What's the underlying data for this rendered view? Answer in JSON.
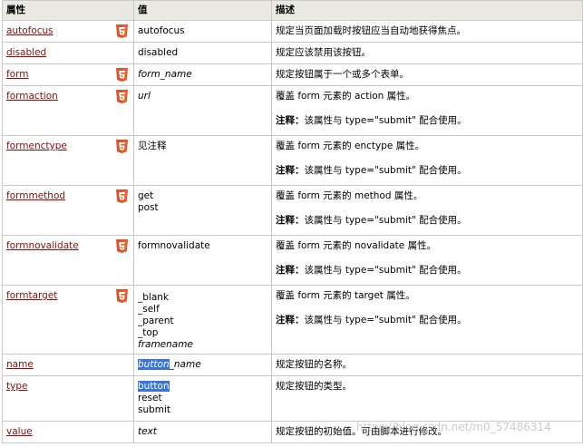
{
  "headers": [
    "属性",
    "值",
    "描述"
  ],
  "note_label": "注释：",
  "note_text": "该属性与 type=\"submit\" 配合使用。",
  "rows": [
    {
      "attr": "autofocus",
      "html5": true,
      "values": [
        "autofocus"
      ],
      "desc": "规定当页面加载时按钮应当自动地获得焦点。"
    },
    {
      "attr": "disabled",
      "html5": false,
      "values": [
        "disabled"
      ],
      "desc": "规定应该禁用该按钮。"
    },
    {
      "attr": "form",
      "html5": true,
      "values": [
        "form_name"
      ],
      "desc": "规定按钮属于一个或多个表单。"
    },
    {
      "attr": "formaction",
      "html5": true,
      "values": [
        "url"
      ],
      "desc": "覆盖 form 元素的 action 属性。"
    },
    {
      "attr": "formenctype",
      "html5": true,
      "values": [
        "见注释"
      ],
      "desc": "覆盖 form 元素的 enctype 属性。"
    },
    {
      "attr": "formmethod",
      "html5": true,
      "values": [
        "get",
        "post"
      ],
      "desc": "覆盖 form 元素的 method 属性。"
    },
    {
      "attr": "formnovalidate",
      "html5": true,
      "values": [
        "formnovalidate"
      ],
      "desc": "覆盖 form 元素的 novalidate 属性。"
    },
    {
      "attr": "formtarget",
      "html5": true,
      "values": [
        "_blank",
        "_self",
        "_parent",
        "_top",
        "framename"
      ],
      "desc": "覆盖 form 元素的 target 属性。"
    },
    {
      "attr": "name",
      "html5": false,
      "values": [
        "button_name"
      ],
      "desc": "规定按钮的名称。"
    },
    {
      "attr": "type",
      "html5": false,
      "values": [
        "button",
        "reset",
        "submit"
      ],
      "desc": "规定按钮的类型。"
    },
    {
      "attr": "value",
      "html5": false,
      "values": [
        "text"
      ],
      "desc": "规定按钮的初始值。可由脚本进行修改。"
    }
  ],
  "name_value_parts": [
    "button",
    "_name"
  ],
  "watermark": "https://blog.csdn.net/m0_57486314"
}
